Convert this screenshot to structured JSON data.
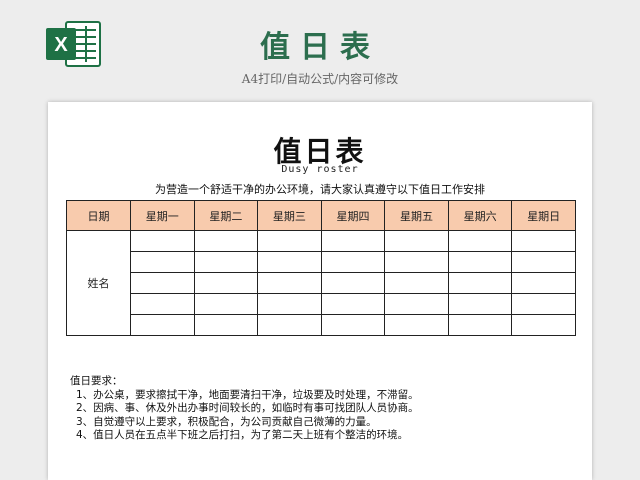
{
  "banner": {
    "title": "值日表",
    "subtitle": "A4打印/自动公式/内容可修改",
    "logo_icon": "excel-icon",
    "logo_letter": "X",
    "accent_color": "#2c6e4e",
    "logo_color": "#1e7145"
  },
  "document": {
    "title": "值日表",
    "subtitle": "Dusy  roster",
    "intro": "为营造一个舒适干净的办公环境，请大家认真遵守以下值日工作安排",
    "header_color": "#f8cbad",
    "table": {
      "headers": [
        "日期",
        "星期一",
        "星期二",
        "星期三",
        "星期四",
        "星期五",
        "星期六",
        "星期日"
      ],
      "row_label": "姓名",
      "row_count": 5
    },
    "requirements": {
      "heading": "值日要求：",
      "items": [
        "1、办公桌，要求擦拭干净，地面要清扫干净，垃圾要及时处理，不滞留。",
        "2、因病、事、休及外出办事时间较长的，如临时有事可找团队人员协商。",
        "3、自觉遵守以上要求，积极配合，为公司贡献自己微薄的力量。",
        "4、值日人员在五点半下班之后打扫，为了第二天上班有个整洁的环境。"
      ]
    }
  }
}
